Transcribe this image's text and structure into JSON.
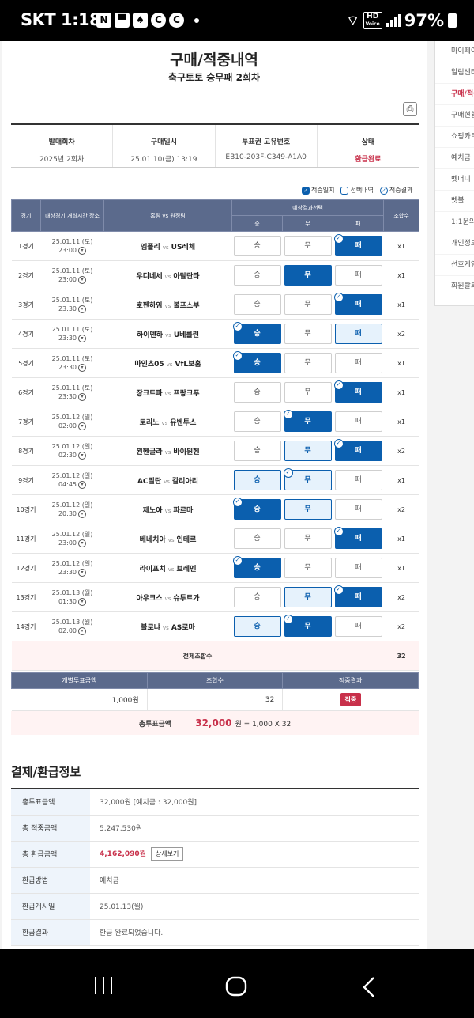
{
  "status_bar": {
    "carrier": "SKT",
    "time": "1:18",
    "battery": "97%",
    "volte": "HD",
    "voice": "Voice"
  },
  "page": {
    "title": "구매/적중내역",
    "subtitle": "축구토토 승무패 2회차"
  },
  "side_menu": [
    "마이페이지",
    "알림센터",
    "구매/적중내역",
    "구매현황",
    "쇼핑카트",
    "예치금",
    "벳머니",
    "벳볼",
    "1:1문의",
    "개인정보",
    "선호게임",
    "회원탈퇴"
  ],
  "info": {
    "headers": [
      "발매회차",
      "구매일시",
      "투표권 고유번호",
      "상태"
    ],
    "values": [
      "2025년 2회차",
      "25.01.10(금) 13:19",
      "EB10-203F-C349-A1A0",
      "환급완료"
    ]
  },
  "legend": {
    "hit": "적중일치",
    "selected": "선택내역",
    "result": "적중결과"
  },
  "table": {
    "headers": {
      "game": "경기",
      "datetime": "대상경기 개최시간 장소",
      "teams": "홈팀 vs 원정팀",
      "prediction": "예상결과선택",
      "win": "승",
      "draw": "무",
      "lose": "패",
      "combo": "조합수"
    },
    "vs": "vs",
    "rows": [
      {
        "game": "1경기",
        "date": "25.01.11 (토)",
        "time": "23:00",
        "home": "엠폴리",
        "away": "US레체",
        "win": "",
        "draw": "",
        "lose": "sel-hit",
        "combo": "x1"
      },
      {
        "game": "2경기",
        "date": "25.01.11 (토)",
        "time": "23:00",
        "home": "우디네세",
        "away": "아탈란타",
        "win": "",
        "draw": "sel",
        "lose": "",
        "combo": "x1"
      },
      {
        "game": "3경기",
        "date": "25.01.11 (토)",
        "time": "23:30",
        "home": "호펜하임",
        "away": "볼프스부",
        "win": "",
        "draw": "",
        "lose": "sel-hit",
        "combo": "x1"
      },
      {
        "game": "4경기",
        "date": "25.01.11 (토)",
        "time": "23:30",
        "home": "하이덴하",
        "away": "U베를린",
        "win": "sel-hit",
        "draw": "",
        "lose": "light",
        "combo": "x2"
      },
      {
        "game": "5경기",
        "date": "25.01.11 (토)",
        "time": "23:30",
        "home": "마인츠05",
        "away": "VfL보훔",
        "win": "sel-hit",
        "draw": "",
        "lose": "",
        "combo": "x1"
      },
      {
        "game": "6경기",
        "date": "25.01.11 (토)",
        "time": "23:30",
        "home": "장크트파",
        "away": "프랑크푸",
        "win": "",
        "draw": "",
        "lose": "sel-hit",
        "combo": "x1"
      },
      {
        "game": "7경기",
        "date": "25.01.12 (일)",
        "time": "02:00",
        "home": "토리노",
        "away": "유벤투스",
        "win": "",
        "draw": "sel-hit",
        "lose": "",
        "combo": "x1"
      },
      {
        "game": "8경기",
        "date": "25.01.12 (일)",
        "time": "02:30",
        "home": "묀헨글라",
        "away": "바이뮌헨",
        "win": "",
        "draw": "light",
        "lose": "sel-hit",
        "combo": "x2"
      },
      {
        "game": "9경기",
        "date": "25.01.12 (일)",
        "time": "04:45",
        "home": "AC밀란",
        "away": "칼리아리",
        "win": "light",
        "draw": "hit",
        "lose": "",
        "combo": "x1"
      },
      {
        "game": "10경기",
        "date": "25.01.12 (일)",
        "time": "20:30",
        "home": "제노아",
        "away": "파르마",
        "win": "sel-hit",
        "draw": "light",
        "lose": "",
        "combo": "x2"
      },
      {
        "game": "11경기",
        "date": "25.01.12 (일)",
        "time": "23:00",
        "home": "베네치아",
        "away": "인테르",
        "win": "",
        "draw": "",
        "lose": "sel-hit",
        "combo": "x1"
      },
      {
        "game": "12경기",
        "date": "25.01.12 (일)",
        "time": "23:30",
        "home": "라이프치",
        "away": "브레멘",
        "win": "sel-hit",
        "draw": "",
        "lose": "",
        "combo": "x1"
      },
      {
        "game": "13경기",
        "date": "25.01.13 (월)",
        "time": "01:30",
        "home": "아우크스",
        "away": "슈투트가",
        "win": "",
        "draw": "light",
        "lose": "sel-hit",
        "combo": "x2"
      },
      {
        "game": "14경기",
        "date": "25.01.13 (월)",
        "time": "02:00",
        "home": "볼로냐",
        "away": "AS로마",
        "win": "light",
        "draw": "sel-hit",
        "lose": "",
        "combo": "x2"
      }
    ],
    "total_label": "전체조합수",
    "total_value": "32"
  },
  "ticket": {
    "headers": [
      "개별투표금액",
      "조합수",
      "적중결과"
    ],
    "amount": "1,000원",
    "combos": "32",
    "result": "적중",
    "total_label": "총투표금액",
    "total_amount": "32,000",
    "total_formula": "원 = 1,000 X 32"
  },
  "payment": {
    "title": "결제/환급정보",
    "rows": [
      {
        "label": "총투표금액",
        "value": "32,000원 [예치금 : 32,000원]"
      },
      {
        "label": "총 적중금액",
        "value": "5,247,530원"
      },
      {
        "label": "총 환급금액",
        "value": "4,162,090원",
        "button": "상세보기"
      },
      {
        "label": "환급방법",
        "value": "예치금"
      },
      {
        "label": "환급개시일",
        "value": "25.01.13(월)"
      },
      {
        "label": "환급결과",
        "value": "환급 완료되었습니다."
      }
    ]
  }
}
